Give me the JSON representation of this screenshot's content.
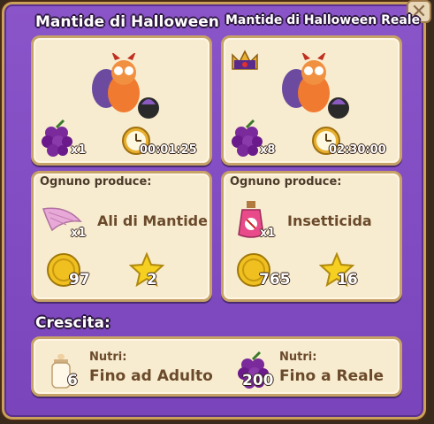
{
  "dialog": {
    "close_icon": "close-icon",
    "left": {
      "title": "Mantide di Halloween",
      "food_count": "x1",
      "time": "00:01:25",
      "produces_label": "Ognuno produce:",
      "product_name": "Ali di Mantide",
      "product_count": "x1",
      "coins": "97",
      "xp": "2"
    },
    "right": {
      "title": "Mantide di Halloween Reale",
      "food_count": "x8",
      "time": "02:30:00",
      "produces_label": "Ognuno produce:",
      "product_name": "Insetticida",
      "product_count": "x1",
      "coins": "765",
      "xp": "16"
    },
    "growth": {
      "title": "Crescita:",
      "adult": {
        "label": "Nutri:",
        "count": "6",
        "target": "Fino ad Adulto"
      },
      "royal": {
        "label": "Nutri:",
        "count": "200",
        "target": "Fino a Reale"
      }
    }
  },
  "colors": {
    "frame": "#7f48c0",
    "panel": "#f8ecd0",
    "border": "#c6a266"
  }
}
